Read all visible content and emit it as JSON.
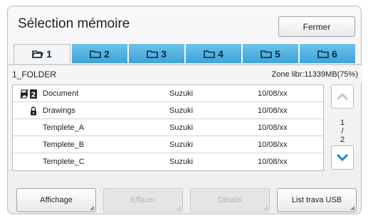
{
  "window": {
    "title": "Sélection mémoire",
    "close_label": "Fermer"
  },
  "tabs": [
    {
      "label": "1",
      "active": true
    },
    {
      "label": "2",
      "active": false
    },
    {
      "label": "3",
      "active": false
    },
    {
      "label": "4",
      "active": false
    },
    {
      "label": "5",
      "active": false
    },
    {
      "label": "6",
      "active": false
    }
  ],
  "folder": {
    "name": "1_FOLDER",
    "free_space": "Zone libr:11339MB(75%)"
  },
  "files": [
    {
      "name": "Document",
      "owner": "Suzuki",
      "date": "10/08/xx",
      "icons": [
        "no-print-icon",
        "badge-2-icon"
      ],
      "badge": "2"
    },
    {
      "name": "Drawings",
      "owner": "Suzuki",
      "date": "10/08/xx",
      "icons": [
        "lock-icon"
      ]
    },
    {
      "name": "Templete_A",
      "owner": "Suzuki",
      "date": "10/08/xx",
      "icons": []
    },
    {
      "name": "Templete_B",
      "owner": "Suzuki",
      "date": "10/08/xx",
      "icons": []
    },
    {
      "name": "Templete_C",
      "owner": "Suzuki",
      "date": "10/08/xx",
      "icons": []
    }
  ],
  "pager": {
    "current": "1",
    "separator": "/",
    "total": "2"
  },
  "buttons": {
    "display": "Affichage",
    "delete": "Effacer",
    "details": "Détails",
    "usb_list": "List trava USB"
  },
  "colors": {
    "tab_blue": "#4fb0e0",
    "scroll_arrow_active": "#1b87c9",
    "scroll_arrow_disabled": "#c5c8cb"
  }
}
